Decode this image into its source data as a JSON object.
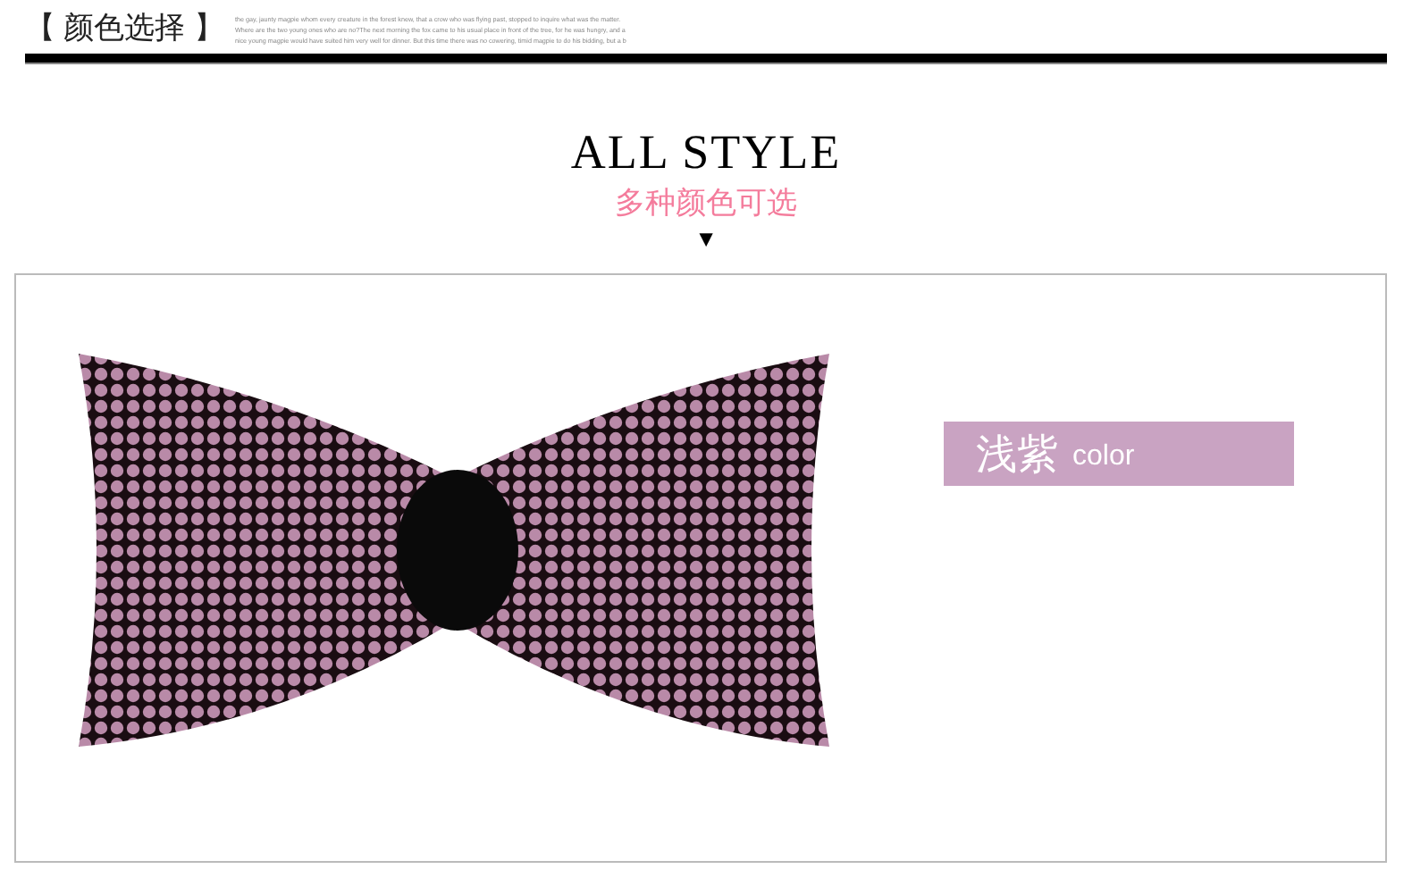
{
  "header": {
    "title": "【 颜色选择 】",
    "blurb": [
      "the gay, jaunty magpie whom every creature in the forest knew, that a crow who was flying past, stopped to inquire what was the matter.",
      "Where are the two young ones who are no?The next morning the fox came to his usual place in front of the tree, for he was hungry, and a",
      "nice young magpie would have suited him very well for dinner. But this time there was no cowering, timid magpie to do his bidding, but a b"
    ]
  },
  "heading": {
    "title": "ALL STYLE",
    "subtitle": "多种颜色可选",
    "marker": "▼"
  },
  "product": {
    "color_name": "浅紫",
    "color_word": "color",
    "color": "#c9a3c2"
  }
}
